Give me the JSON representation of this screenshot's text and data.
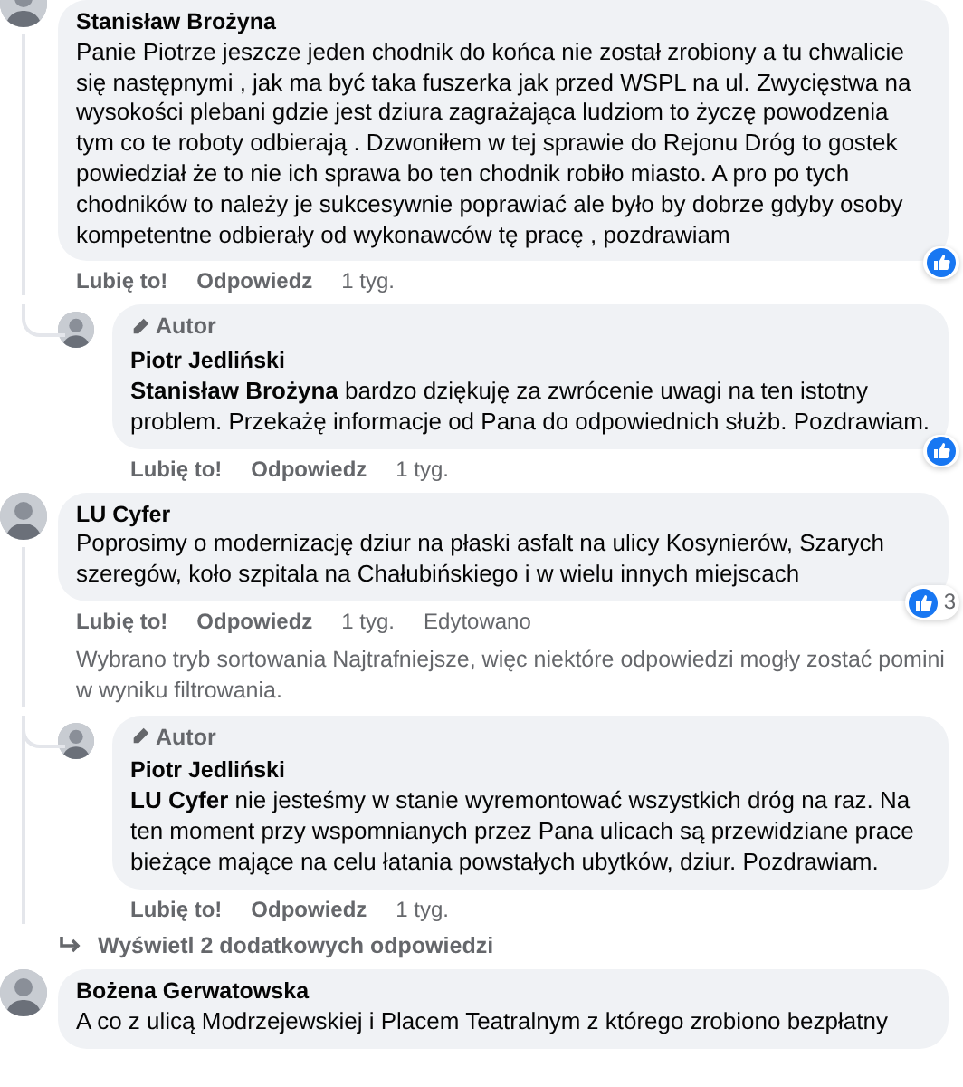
{
  "items": [
    {
      "kind": "comment",
      "author": "Stanisław Brożyna",
      "text": "Panie Piotrze jeszcze jeden chodnik do końca nie został zrobiony a tu chwalicie się następnymi , jak ma być taka fuszerka jak przed WSPL na ul. Zwycięstwa na wysokości plebani gdzie jest dziura zagrażająca ludziom to życzę powodzenia tym co te roboty odbierają . Dzwoniłem w tej sprawie do Rejonu Dróg to gostek powiedział że to nie ich sprawa bo ten chodnik robiło miasto. A pro po tych chodników to należy je sukcesywnie poprawiać ale było by dobrze gdyby osoby kompetentne odbierały od wykonawców tę pracę , pozdrawiam",
      "like": "Lubię to!",
      "reply": "Odpowiedz",
      "time": "1 tyg.",
      "reacted": true
    },
    {
      "kind": "reply",
      "badge": "Autor",
      "author": "Piotr Jedliński",
      "text": "**Stanisław Brożyna** bardzo dziękuję za zwrócenie uwagi na ten istotny problem. Przekażę informacje od Pana do odpowiednich służb. Pozdrawiam.",
      "like": "Lubię to!",
      "reply": "Odpowiedz",
      "time": "1 tyg.",
      "reacted": true
    },
    {
      "kind": "comment",
      "author": "LU Cyfer",
      "text": "Poprosimy o modernizację dziur na płaski asfalt na ulicy Kosynierów, Szarych szeregów, koło szpitala na Chałubińskiego i w wielu innych miejscach",
      "like": "Lubię to!",
      "reply": "Odpowiedz",
      "time": "1 tyg.",
      "edited": "Edytowano",
      "reacted": true,
      "reaction_count": "3"
    },
    {
      "kind": "notice",
      "lines": [
        "Wybrano tryb sortowania Najtrafniejsze, więc niektóre odpowiedzi mogły zostać pomini",
        "w wyniku filtrowania."
      ]
    },
    {
      "kind": "reply",
      "badge": "Autor",
      "author": "Piotr Jedliński",
      "text": "**LU Cyfer** nie jesteśmy w stanie wyremontować wszystkich dróg na raz. Na ten moment przy wspomnianych przez Pana ulicach są przewidziane prace bieżące mające na celu łatania powstałych ubytków, dziur. Pozdrawiam.",
      "like": "Lubię to!",
      "reply": "Odpowiedz",
      "time": "1 tyg.",
      "reacted": false
    },
    {
      "kind": "more",
      "label": "Wyświetl 2 dodatkowych odpowiedzi"
    },
    {
      "kind": "comment",
      "author": "Bożena Gerwatowska",
      "text": "A co z ulicą Modrzejewskiej i Placem Teatralnym z którego zrobiono bezpłatny"
    }
  ]
}
